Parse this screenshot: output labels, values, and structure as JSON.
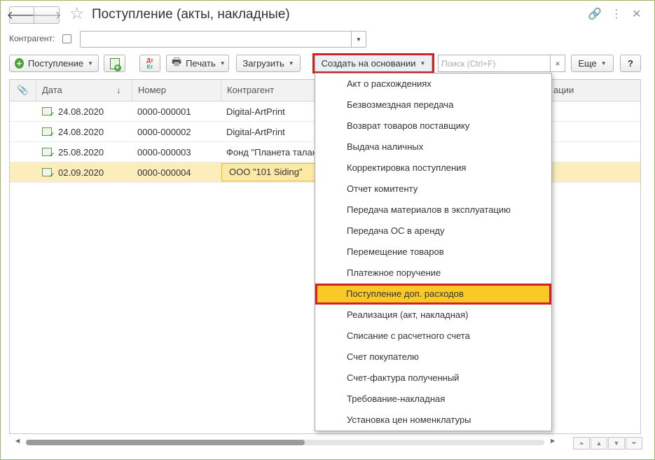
{
  "window": {
    "title": "Поступление (акты, накладные)",
    "back_icon": "arrow-left-icon",
    "forward_icon": "arrow-right-icon",
    "favorite_icon": "star-icon",
    "link_icon": "link-icon",
    "more_icon": "kebab-icon",
    "close_icon": "close-icon"
  },
  "filter": {
    "label": "Контрагент:",
    "checked": false,
    "value": ""
  },
  "toolbar": {
    "postuplenie": "Поступление",
    "dt": "Дт",
    "kt": "Кт",
    "print": "Печать",
    "load": "Загрузить",
    "create_based": "Создать на основании",
    "search_placeholder": "Поиск (Ctrl+F)",
    "search_clear": "×",
    "more": "Еще",
    "help": "?"
  },
  "table": {
    "columns": {
      "date": "Дата",
      "sort_arrow": "↓",
      "number": "Номер",
      "counterparty": "Контрагент",
      "hidden_tail": "ации"
    },
    "rows": [
      {
        "date": "24.08.2020",
        "number": "0000-000001",
        "counterparty": "Digital-ArtPrint"
      },
      {
        "date": "24.08.2020",
        "number": "0000-000002",
        "counterparty": "Digital-ArtPrint"
      },
      {
        "date": "25.08.2020",
        "number": "0000-000003",
        "counterparty": "Фонд \"Планета талан"
      },
      {
        "date": "02.09.2020",
        "number": "0000-000004",
        "counterparty": "ООО \"101 Siding\"",
        "selected": true
      }
    ]
  },
  "menu": {
    "items": [
      "Акт о расхождениях",
      "Безвозмездная передача",
      "Возврат товаров поставщику",
      "Выдача наличных",
      "Корректировка поступления",
      "Отчет комитенту",
      "Передача материалов в эксплуатацию",
      "Передача ОС в аренду",
      "Перемещение товаров",
      "Платежное поручение",
      "Поступление доп. расходов",
      "Реализация (акт, накладная)",
      "Списание с расчетного счета",
      "Счет покупателю",
      "Счет-фактура полученный",
      "Требование-накладная",
      "Установка цен номенклатуры"
    ],
    "active_index": 10
  },
  "colors": {
    "accent_red": "#d32027",
    "highlight_yellow": "#fac924",
    "selected_row": "#fbeebc"
  }
}
